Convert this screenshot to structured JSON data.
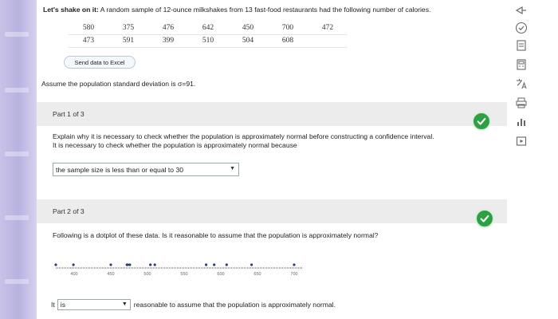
{
  "problem": {
    "intro_bold": "Let's shake on it:",
    "intro_text": " A random sample of 12-ounce milkshakes from 13 fast-food restaurants had the following number of calories.",
    "table_rows": [
      [
        "580",
        "375",
        "476",
        "642",
        "450",
        "700",
        "472"
      ],
      [
        "473",
        "591",
        "399",
        "510",
        "504",
        "608",
        ""
      ]
    ],
    "excel_button": "Send data to Excel",
    "sigma_text": "Assume the population standard deviation is σ=91."
  },
  "part1": {
    "header": "Part 1 of 3",
    "question": "Explain why it is necessary to check whether the population is approximately normal before constructing a confidence interval.",
    "prompt": "It is necessary to check whether the population is approximately normal because",
    "selected": "the sample size is less than or equal to 30",
    "select_arrow": "▼",
    "status": "correct"
  },
  "part2": {
    "header": "Part 2 of 3",
    "question": "Following is a dotplot of these data. Is it reasonable to assume that the population is approximately normal?",
    "answer_prefix": "It",
    "selected": "is",
    "select_arrow": "▼",
    "answer_suffix": "reasonable to assume that the population is approximately normal.",
    "status": "correct"
  },
  "dotplot": {
    "ticks": [
      "400",
      "450",
      "500",
      "550",
      "600",
      "650",
      "700"
    ],
    "axis_min": 375,
    "axis_max": 712,
    "values": [
      375,
      399,
      450,
      472,
      473,
      476,
      504,
      510,
      580,
      591,
      608,
      642,
      700
    ]
  },
  "toolbar": {
    "icons": [
      "pin-icon",
      "check-circle-icon",
      "doc-icon",
      "calculator-icon",
      "translate-icon",
      "print-icon",
      "chart-icon",
      "video-icon"
    ]
  },
  "colors": {
    "check_green": "#2ea043",
    "part_header_bg": "#ececec",
    "left_strip": "#c9c3e8"
  }
}
